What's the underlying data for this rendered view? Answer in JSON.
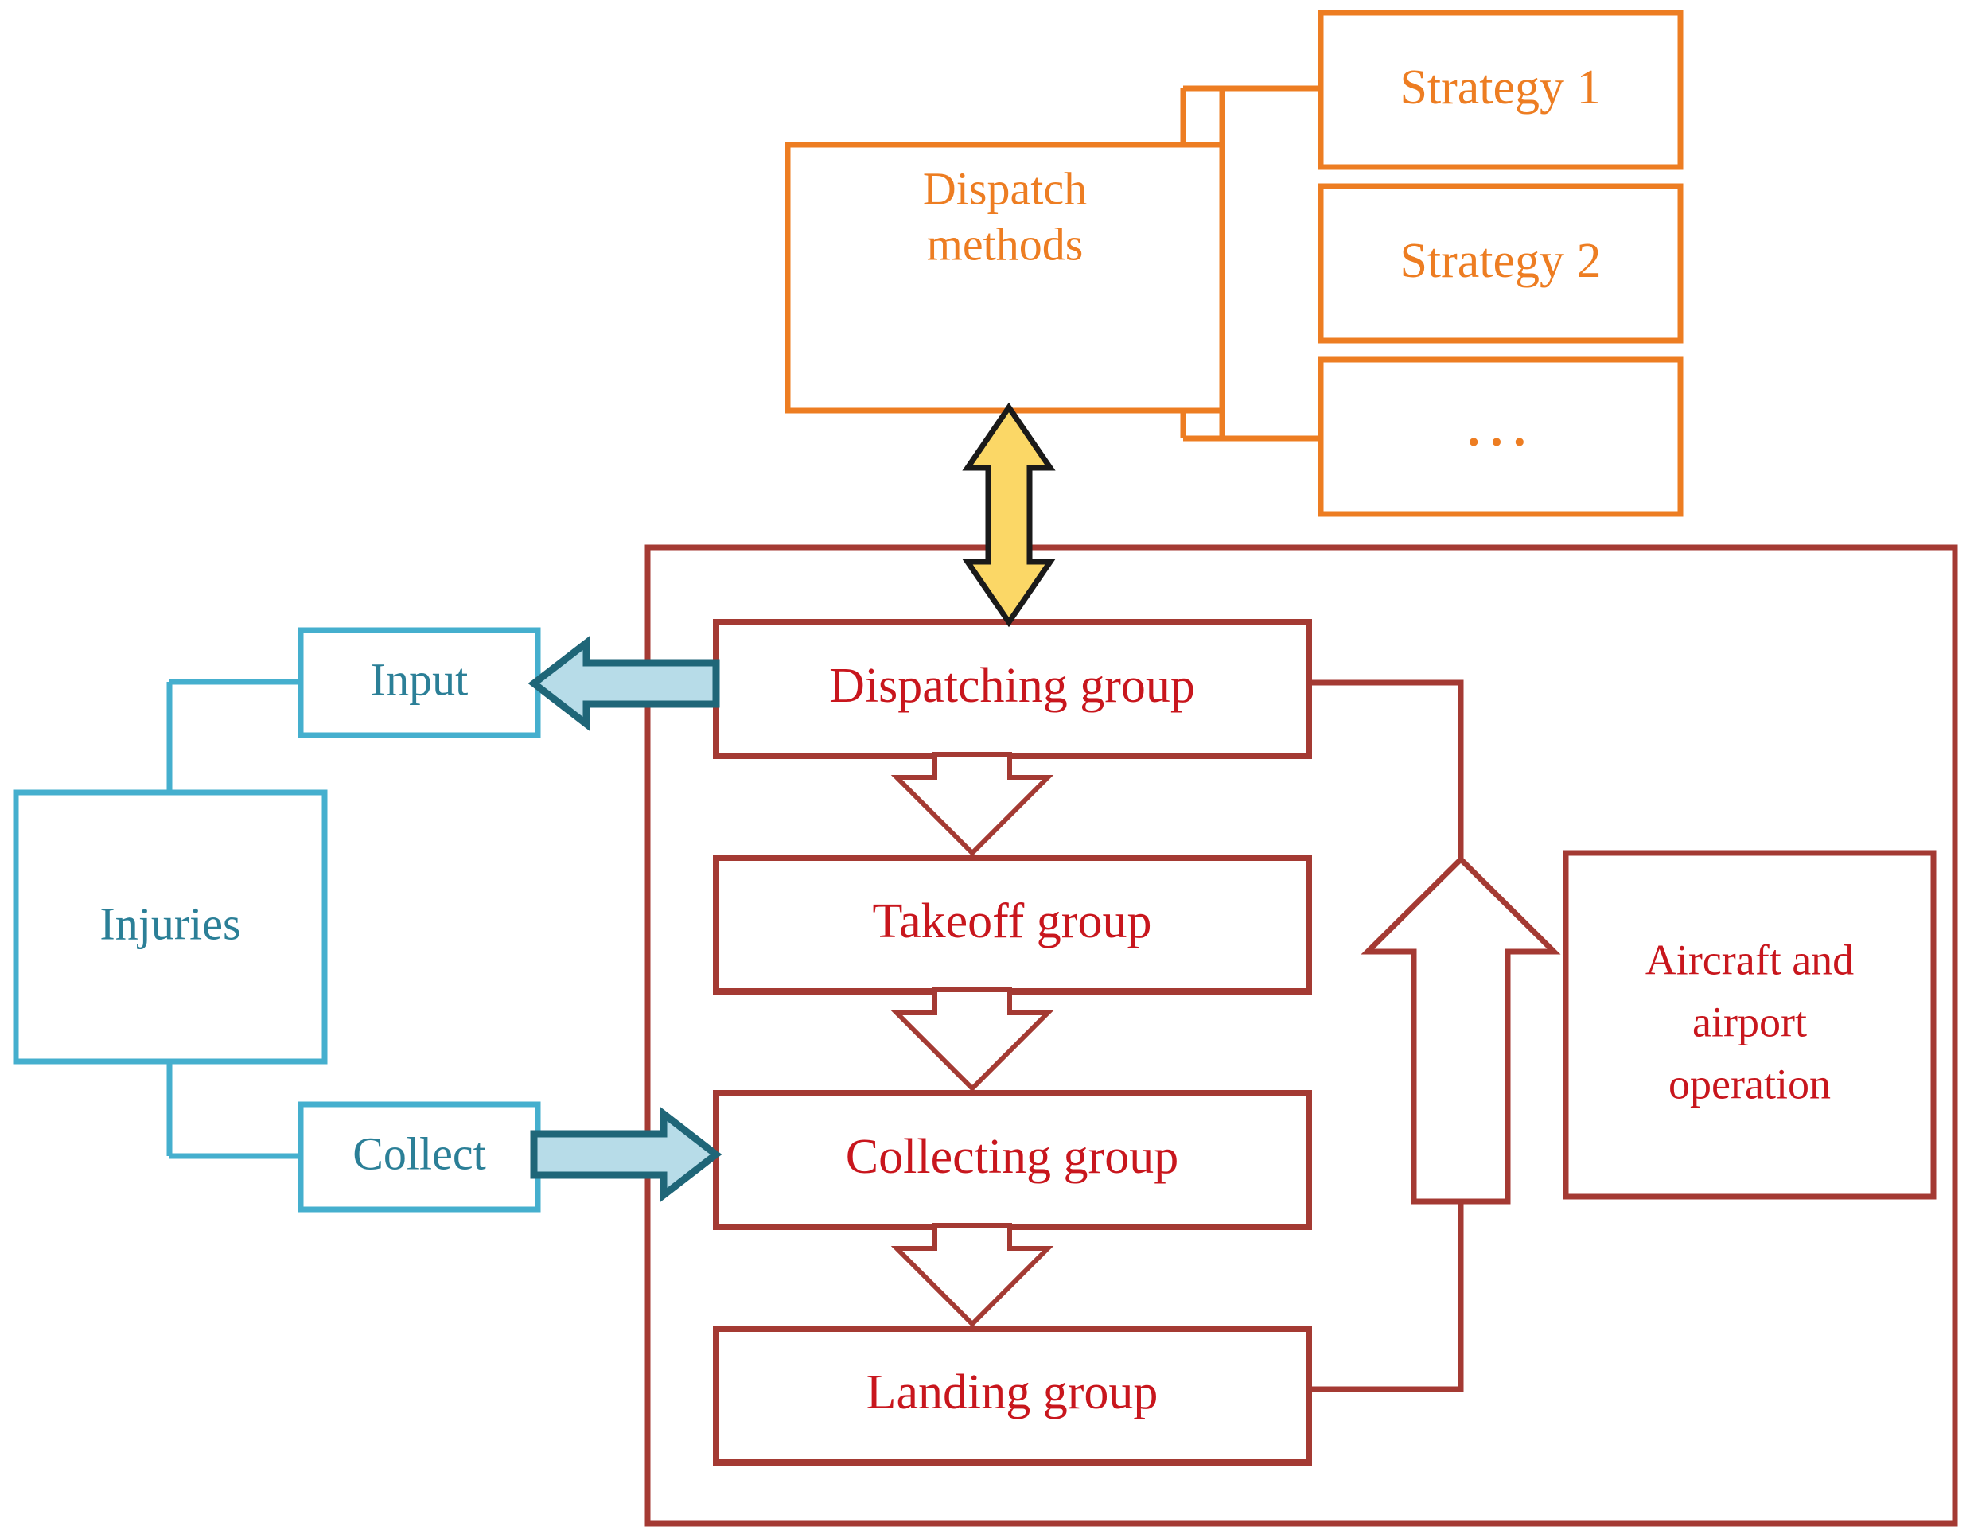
{
  "diagram": {
    "title": "Emergency medical dispatch system flow diagram",
    "colors": {
      "orange": "#ED7D22",
      "cyan_stroke": "#45AFCE",
      "cyan_text": "#2B7F97",
      "red_box": "#A43A33",
      "red_text": "#C8161D",
      "yellow_fill": "#FBD766",
      "yellow_stroke": "#1A1A1A",
      "blue_arrow_fill": "#B7DCE8",
      "blue_arrow_stroke": "#1F6678",
      "background": "#FFFFFF"
    }
  },
  "strategy_panel": {
    "source_label": "Dispatch\nmethods",
    "source_line1": "Dispatch",
    "source_line2": "methods",
    "options": [
      {
        "label": "Strategy 1"
      },
      {
        "label": "Strategy 2"
      },
      {
        "label": "…"
      }
    ]
  },
  "patient_flow": {
    "source_label": "Injuries",
    "input_label": "Input",
    "collect_label": "Collect"
  },
  "operation_container": {
    "stages": [
      {
        "label": "Dispatching group"
      },
      {
        "label": "Takeoff group"
      },
      {
        "label": "Collecting group"
      },
      {
        "label": "Landing group"
      }
    ],
    "resource_box": {
      "line1": "Aircraft and",
      "line2": "airport",
      "line3": "operation"
    }
  },
  "connectors": {
    "dispatch_link_label": "Dispatch methods to Dispatching group (bidirectional)",
    "input_link_label": "Input to Dispatching group",
    "collect_link_label": "Collecting group to Collect",
    "feedback_link_label": "Landing group back to Dispatching group"
  }
}
